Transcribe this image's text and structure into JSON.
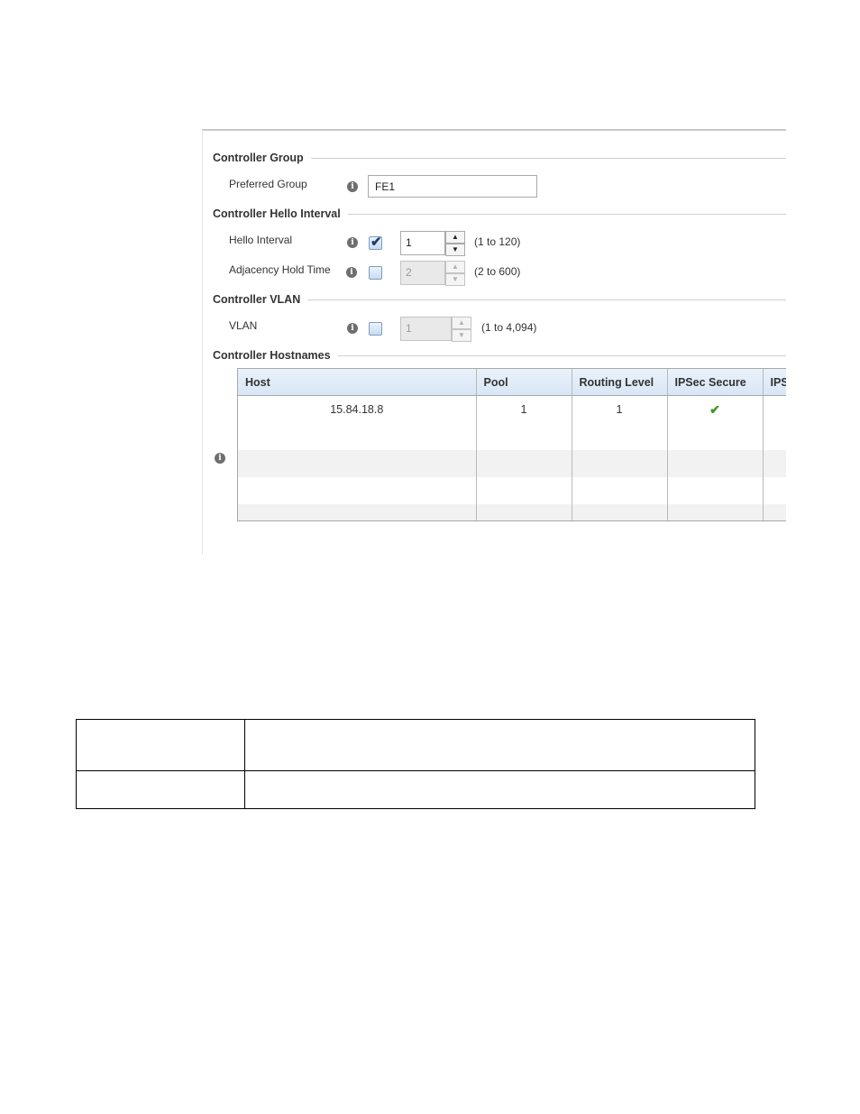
{
  "sections": {
    "controller_group": "Controller Group",
    "hello_interval": "Controller Hello Interval",
    "vlan": "Controller VLAN",
    "hostnames": "Controller Hostnames"
  },
  "preferred_group": {
    "label": "Preferred Group",
    "value": "FE1"
  },
  "hello_interval": {
    "label": "Hello Interval",
    "checked": true,
    "value": "1",
    "range": "(1 to 120)"
  },
  "adjacency_hold_time": {
    "label": "Adjacency Hold Time",
    "checked": false,
    "value": "2",
    "range": "(2 to 600)"
  },
  "vlan": {
    "label": "VLAN",
    "checked": false,
    "value": "1",
    "range": "(1 to 4,094)"
  },
  "hostnames_table": {
    "columns": [
      "Host",
      "Pool",
      "Routing Level",
      "IPSec Secure",
      "IPS"
    ],
    "rows": [
      {
        "host": "15.84.18.8",
        "pool": "1",
        "routing_level": "1",
        "ipsec_secure": "check-icon"
      }
    ]
  },
  "icons": {
    "info": "i",
    "tick": "✔",
    "spin_up": "▲",
    "spin_down": "▼"
  },
  "colors": {
    "header_gradient": "#d7e6f6",
    "check_green": "#3a9a1e",
    "checkbox_border": "#7a9cc6"
  }
}
